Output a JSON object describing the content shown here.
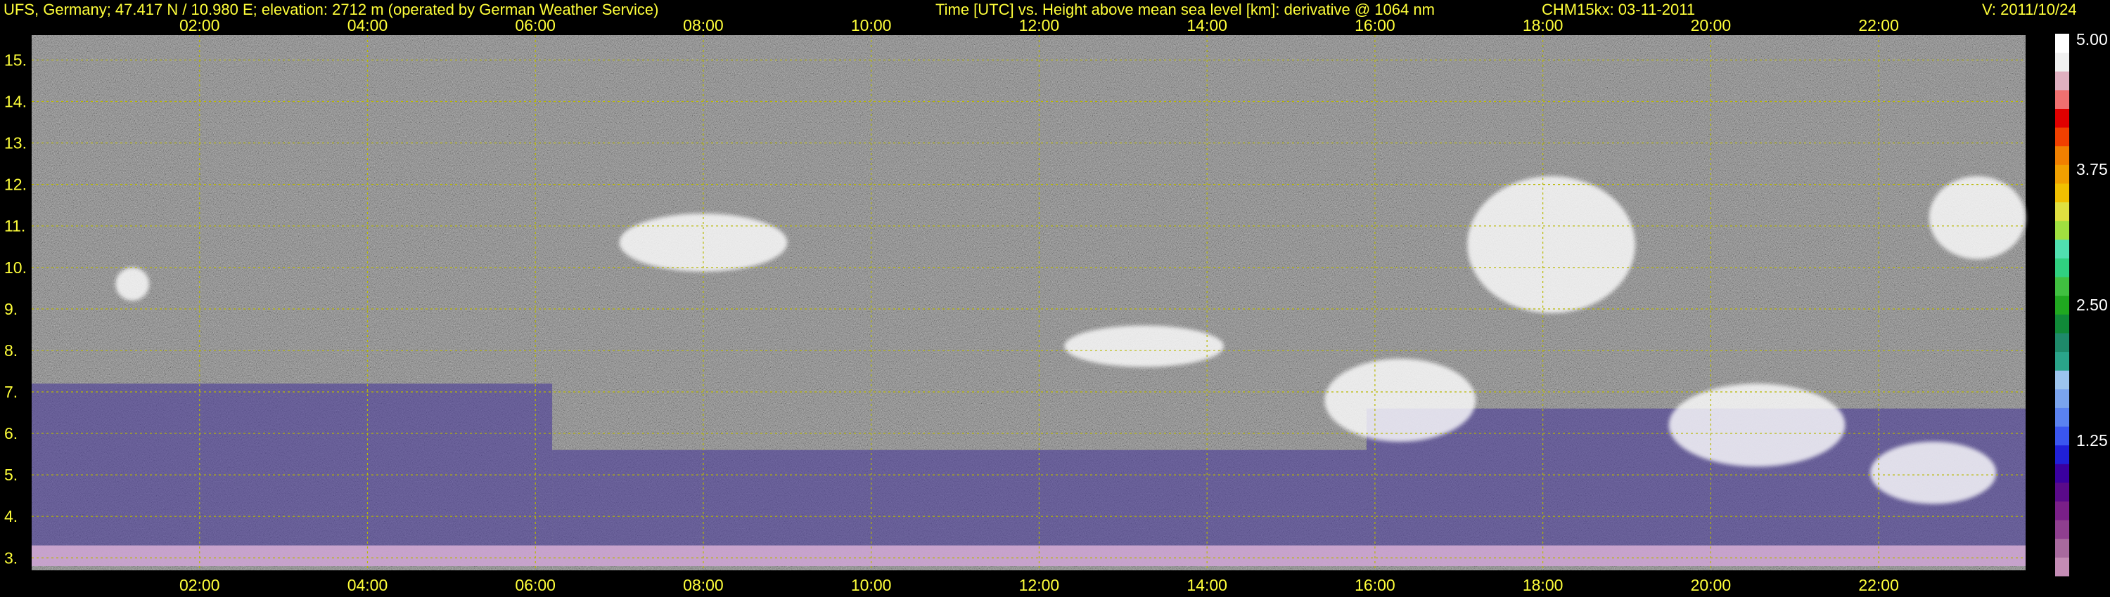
{
  "header": {
    "site": "UFS, Germany; 47.417 N / 10.980 E; elevation: 2712 m  (operated by German Weather Service)",
    "axes_desc": "Time [UTC] vs. Height above mean sea level [km]: derivative @ 1064 nm",
    "instrument_date": "CHM15kx: 03-11-2011",
    "version": "V: 2011/10/24"
  },
  "colors": {
    "header_text": "#ffff3a",
    "grid": "#b8b800",
    "background": "#000000",
    "plot_noise": "#8a8a8a",
    "aerosol_layer": "#4a3a9a",
    "surface_layer": "#c9a3cf"
  },
  "chart_data": {
    "type": "heatmap",
    "xlabel": "Time [UTC]",
    "ylabel": "Height above mean sea level [km]",
    "x_ticks": [
      "02:00",
      "04:00",
      "06:00",
      "08:00",
      "10:00",
      "12:00",
      "14:00",
      "16:00",
      "18:00",
      "20:00",
      "22:00"
    ],
    "x_tick_hours": [
      2,
      4,
      6,
      8,
      10,
      12,
      14,
      16,
      18,
      20,
      22
    ],
    "xlim_hours": [
      0.0,
      23.75
    ],
    "y_ticks": [
      "3.",
      "4.",
      "5.",
      "6.",
      "7.",
      "8.",
      "9.",
      "10.",
      "11.",
      "12.",
      "13.",
      "14.",
      "15."
    ],
    "y_tick_km": [
      3,
      4,
      5,
      6,
      7,
      8,
      9,
      10,
      11,
      12,
      13,
      14,
      15
    ],
    "ylim_km": [
      2.7,
      15.6
    ],
    "grid": true,
    "colorbar": {
      "ticks": [
        "5.00",
        "3.75",
        "2.50",
        "1.25"
      ],
      "tick_values": [
        5.0,
        3.75,
        2.5,
        1.25
      ],
      "range": [
        0,
        5.0
      ],
      "colors": [
        "#c48cb5",
        "#a86a9e",
        "#8f3f8f",
        "#7a1f88",
        "#5a0a8a",
        "#3a00a0",
        "#2020d8",
        "#3a56ef",
        "#5a82f0",
        "#7aa4ee",
        "#9cc4ee",
        "#2aa48a",
        "#1e8a6a",
        "#108a38",
        "#20a820",
        "#40c040",
        "#30d080",
        "#50e0b0",
        "#a0e040",
        "#e0e040",
        "#f0c000",
        "#f0a000",
        "#f08000",
        "#f04000",
        "#e00000",
        "#f07070",
        "#e0b0c0",
        "#f0f0f0",
        "#ffffff"
      ]
    },
    "features": [
      {
        "kind": "surface_layer",
        "t0": 0.0,
        "t1": 23.75,
        "h0": 2.8,
        "h1": 3.3
      },
      {
        "kind": "aerosol_layer",
        "t0": 0.0,
        "t1": 6.2,
        "h0": 3.3,
        "h1": 7.2
      },
      {
        "kind": "aerosol_layer",
        "t0": 6.2,
        "t1": 15.9,
        "h0": 3.3,
        "h1": 5.6
      },
      {
        "kind": "aerosol_layer",
        "t0": 15.9,
        "t1": 23.75,
        "h0": 3.3,
        "h1": 6.6
      },
      {
        "kind": "cloud",
        "t0": 17.1,
        "t1": 19.1,
        "h0": 8.9,
        "h1": 12.2
      },
      {
        "kind": "cloud",
        "t0": 19.5,
        "t1": 21.6,
        "h0": 5.2,
        "h1": 7.2
      },
      {
        "kind": "cloud",
        "t0": 15.4,
        "t1": 17.2,
        "h0": 5.8,
        "h1": 7.8
      },
      {
        "kind": "cloud",
        "t0": 22.6,
        "t1": 23.75,
        "h0": 10.2,
        "h1": 12.2
      },
      {
        "kind": "cloud",
        "t0": 21.9,
        "t1": 23.4,
        "h0": 4.3,
        "h1": 5.8
      },
      {
        "kind": "cloud",
        "t0": 12.3,
        "t1": 14.2,
        "h0": 7.6,
        "h1": 8.6
      },
      {
        "kind": "cloud",
        "t0": 7.0,
        "t1": 9.0,
        "h0": 9.9,
        "h1": 11.3
      },
      {
        "kind": "cloud",
        "t0": 1.0,
        "t1": 1.4,
        "h0": 9.2,
        "h1": 10.0
      }
    ]
  }
}
